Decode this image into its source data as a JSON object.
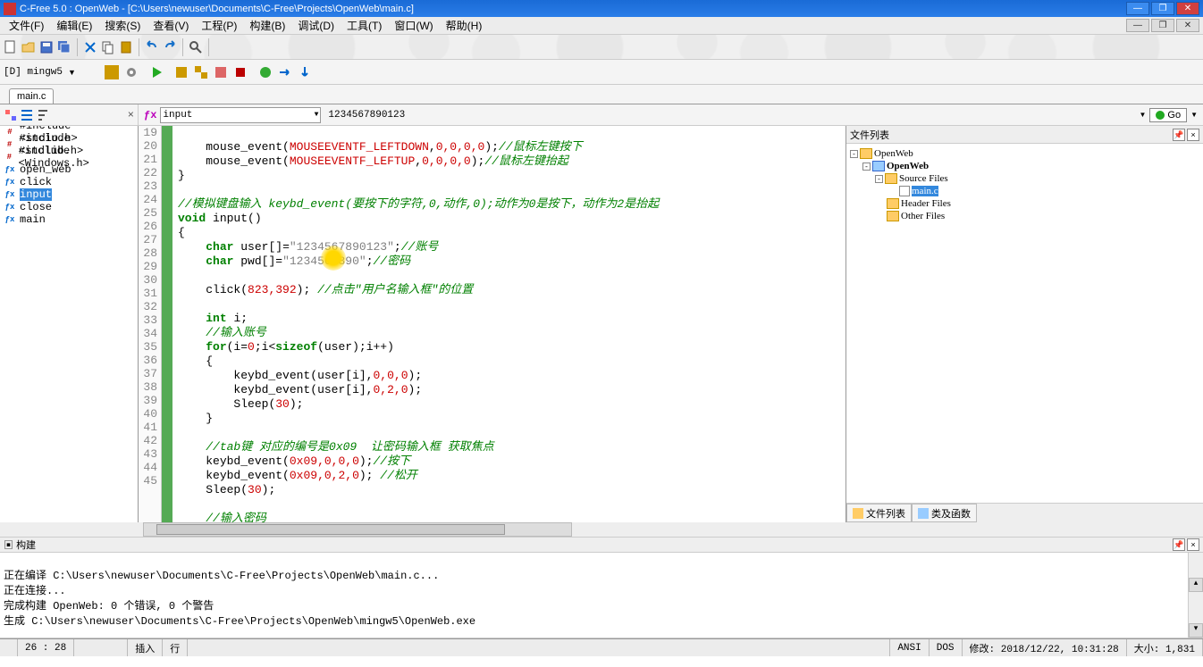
{
  "title": "C-Free 5.0 : OpenWeb - [C:\\Users\\newuser\\Documents\\C-Free\\Projects\\OpenWeb\\main.c]",
  "menu": [
    "文件(F)",
    "编辑(E)",
    "搜索(S)",
    "查看(V)",
    "工程(P)",
    "构建(B)",
    "调试(D)",
    "工具(T)",
    "窗口(W)",
    "帮助(H)"
  ],
  "compiler": "[D] mingw5",
  "tab": "main.c",
  "nav": {
    "func": "input",
    "value": "1234567890123",
    "go": "Go"
  },
  "symbols": [
    {
      "type": "inc",
      "text": "#include <stdio.h>"
    },
    {
      "type": "inc",
      "text": "#include <stdlib.h>"
    },
    {
      "type": "inc",
      "text": "#include <Windows.h>"
    },
    {
      "type": "fn",
      "text": "open_web"
    },
    {
      "type": "fn",
      "text": "click"
    },
    {
      "type": "fn",
      "text": "input",
      "sel": true
    },
    {
      "type": "fn",
      "text": "close"
    },
    {
      "type": "fn",
      "text": "main"
    }
  ],
  "lines": [
    19,
    20,
    21,
    22,
    23,
    24,
    25,
    26,
    27,
    28,
    29,
    30,
    31,
    32,
    33,
    34,
    35,
    36,
    37,
    38,
    39,
    40,
    41,
    42,
    43,
    44,
    45
  ],
  "right": {
    "title": "文件列表",
    "tree": {
      "root": "OpenWeb",
      "proj": "OpenWeb",
      "folders": [
        "Source Files",
        "Header Files",
        "Other Files"
      ],
      "file": "main.c"
    },
    "tabs": [
      "文件列表",
      "类及函数"
    ]
  },
  "bottom": {
    "title": "构建",
    "lines": [
      "正在编译 C:\\Users\\newuser\\Documents\\C-Free\\Projects\\OpenWeb\\main.c...",
      "正在连接...",
      "",
      "完成构建 OpenWeb: 0 个错误, 0 个警告",
      "生成 C:\\Users\\newuser\\Documents\\C-Free\\Projects\\OpenWeb\\mingw5\\OpenWeb.exe"
    ]
  },
  "status": {
    "pos": "26 : 28",
    "mode": "插入",
    "row": "行",
    "enc": "ANSI",
    "os": "DOS",
    "modified": "修改: 2018/12/22, 10:31:28",
    "size": "大小: 1,831"
  },
  "code": {
    "l19": {
      "fn": "mouse_event",
      "c1": "MOUSEEVENTF_LEFTDOWN",
      "n": "0,0,0,0",
      "cm": "//鼠标左键按下"
    },
    "l20": {
      "fn": "mouse_event",
      "c1": "MOUSEEVENTF_LEFTUP",
      "n": "0,0,0,0",
      "cm": "//鼠标左键抬起"
    },
    "l23": "//模拟键盘输入 keybd_event(要按下的字符,0,动作,0);动作为0是按下，动作为2是抬起",
    "l24": {
      "kw": "void",
      "fn": "input"
    },
    "l26": {
      "kw": "char",
      "id": "user",
      "str": "\"1234567890123\"",
      "cm": "//账号"
    },
    "l27": {
      "kw": "char",
      "id": "pwd",
      "str": "\"1234567890\"",
      "cm": "//密码"
    },
    "l29": {
      "fn": "click",
      "n": "823,392",
      "cm": "//点击\"用户名输入框\"的位置"
    },
    "l31": {
      "kw": "int",
      "id": "i"
    },
    "l32": "//输入账号",
    "l33": {
      "kw1": "for",
      "kw2": "sizeof",
      "id": "user"
    },
    "l35": {
      "fn": "keybd_event",
      "id": "user",
      "n": "0,0,0"
    },
    "l36": {
      "fn": "keybd_event",
      "id": "user",
      "n": "0,2,0"
    },
    "l37": {
      "fn": "Sleep",
      "n": "30"
    },
    "l40": "//tab键 对应的编号是0x09  让密码输入框 获取焦点",
    "l41": {
      "fn": "keybd_event",
      "n": "0x09,0,0,0",
      "cm": "//按下"
    },
    "l42": {
      "fn": "keybd_event",
      "n": "0x09,0,2,0",
      "cm": "//松开"
    },
    "l43": {
      "fn": "Sleep",
      "n": "30"
    },
    "l45": "//输入密码"
  }
}
